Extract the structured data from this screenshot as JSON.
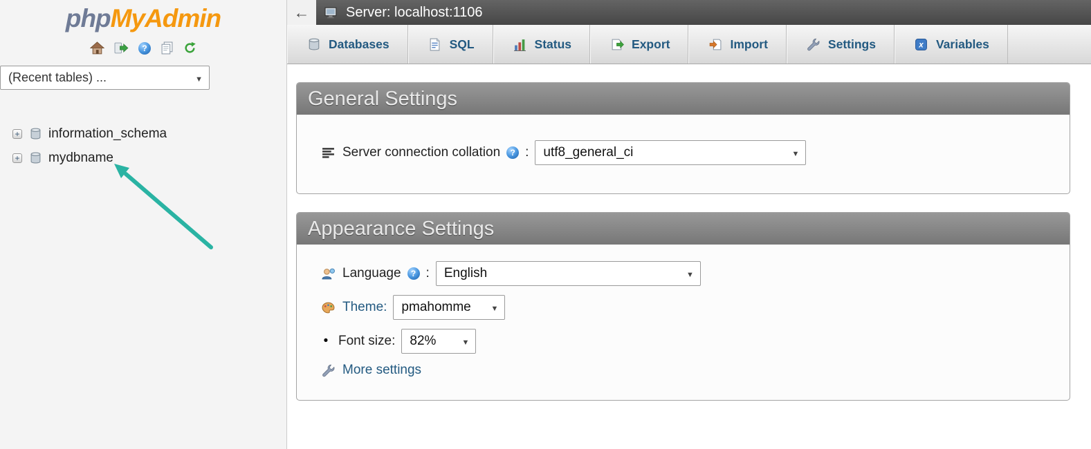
{
  "colors": {
    "accent_blue": "#235a81",
    "logo_orange": "#f5980f",
    "logo_gray": "#6f7b96",
    "annotation_teal": "#2ab3a3",
    "server_bar_gray": "#4f4f4f"
  },
  "sidebar": {
    "logo_php": "php",
    "logo_myadmin": "MyAdmin",
    "recent_tables_value": "(Recent tables) ...",
    "tree": [
      {
        "label": "information_schema"
      },
      {
        "label": "mydbname"
      }
    ]
  },
  "server_bar": {
    "back_arrow": "←",
    "label": "Server: localhost:1106"
  },
  "tabs": [
    {
      "label": "Databases"
    },
    {
      "label": "SQL"
    },
    {
      "label": "Status"
    },
    {
      "label": "Export"
    },
    {
      "label": "Import"
    },
    {
      "label": "Settings"
    },
    {
      "label": "Variables"
    }
  ],
  "general_settings": {
    "title": "General Settings",
    "collation_label": "Server connection collation",
    "colon": ":",
    "collation_value": "utf8_general_ci"
  },
  "appearance_settings": {
    "title": "Appearance Settings",
    "language_label": "Language",
    "colon": ":",
    "language_value": "English",
    "theme_label": "Theme:",
    "theme_value": "pmahomme",
    "font_size_bullet": "•",
    "font_size_label": "Font size:",
    "font_size_value": "82%",
    "more_settings_label": "More settings"
  }
}
